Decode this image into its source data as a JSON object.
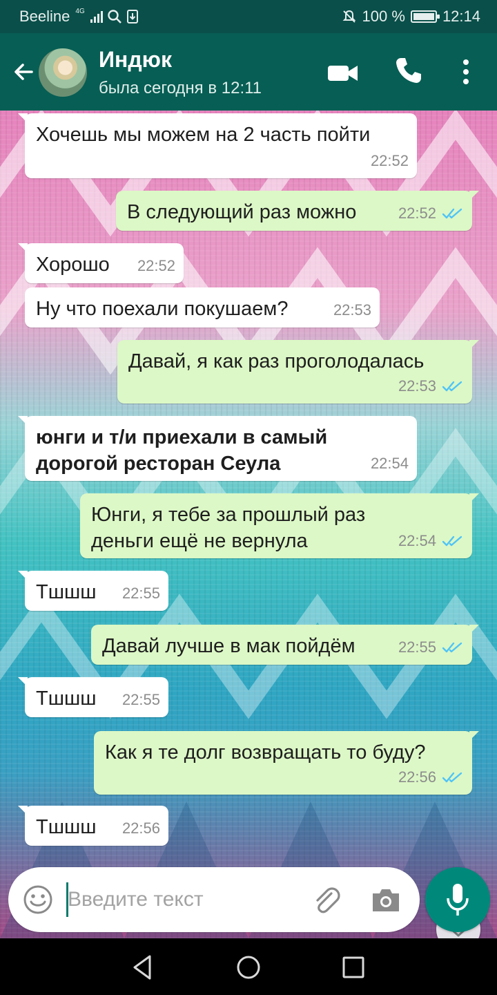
{
  "status_bar": {
    "carrier": "Beeline",
    "network": "4G",
    "battery_percent": "100 %",
    "battery_level": 1.0,
    "time": "12:14",
    "icons": [
      "signal-icon",
      "search-icon",
      "download-icon",
      "mute-icon",
      "battery-icon"
    ]
  },
  "header": {
    "contact_name": "Индюк",
    "contact_status": "была сегодня в 12:11",
    "icons": [
      "back-arrow-icon",
      "avatar",
      "video-call-icon",
      "phone-icon",
      "more-vert-icon"
    ]
  },
  "messages": [
    {
      "direction": "in",
      "text": "Хочешь мы можем на 2 часть пойти",
      "time": "22:52",
      "bold": false
    },
    {
      "direction": "out",
      "text": "В следующий раз можно",
      "time": "22:52",
      "status": "read"
    },
    {
      "direction": "in",
      "text": "Хорошо",
      "time": "22:52",
      "bold": false
    },
    {
      "direction": "in",
      "text": "Ну что поехали покушаем?",
      "time": "22:53",
      "bold": false
    },
    {
      "direction": "out",
      "text": "Давай, я как раз проголодалась",
      "time": "22:53",
      "status": "read"
    },
    {
      "direction": "in",
      "text": "юнги и т/и приехали в самый дорогой ресторан Сеула",
      "time": "22:54",
      "bold": true
    },
    {
      "direction": "out",
      "text": "Юнги, я тебе за прошлый раз деньги ещё не вернула",
      "time": "22:54",
      "status": "read"
    },
    {
      "direction": "in",
      "text": "Тшшш",
      "time": "22:55",
      "bold": false
    },
    {
      "direction": "out",
      "text": "Давай лучше в мак пойдём",
      "time": "22:55",
      "status": "read"
    },
    {
      "direction": "in",
      "text": "Тшшш",
      "time": "22:55",
      "bold": false
    },
    {
      "direction": "out",
      "text": "Как я те долг возвращать то буду?",
      "time": "22:56",
      "status": "read"
    },
    {
      "direction": "in",
      "text": "Тшшш",
      "time": "22:56",
      "bold": false
    }
  ],
  "input": {
    "placeholder": "Введите текст",
    "value": ""
  },
  "colors": {
    "header": "#075e54",
    "status_bar": "#0a4f49",
    "outgoing_bubble": "#dcf8c6",
    "incoming_bubble": "#ffffff",
    "read_ticks": "#4fc3f7",
    "mic_button": "#00897b"
  }
}
